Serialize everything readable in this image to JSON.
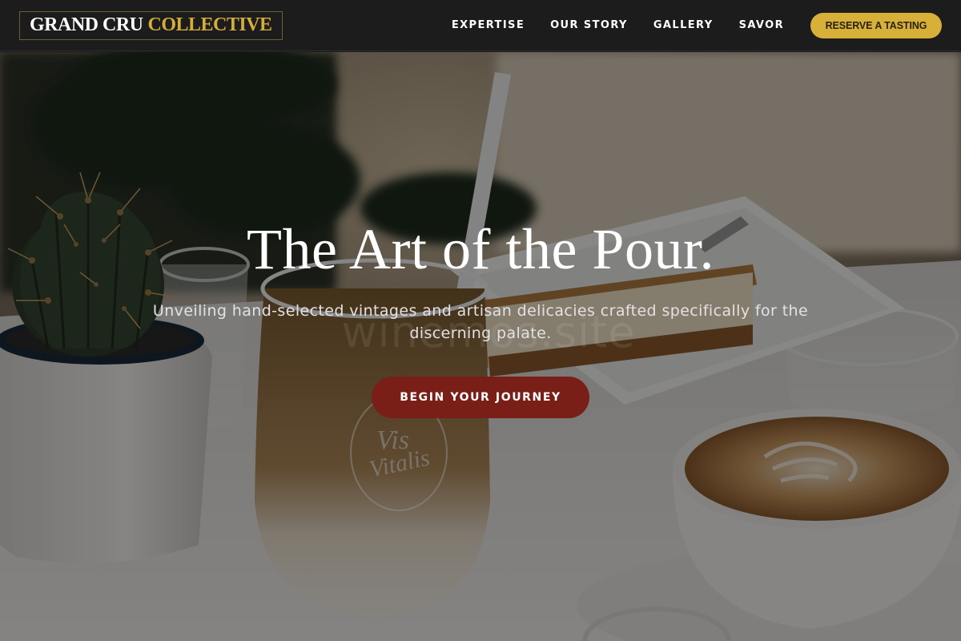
{
  "header": {
    "logo_primary": "GRAND CRU",
    "logo_accent": "COLLECTIVE",
    "nav": [
      {
        "label": "EXPERTISE"
      },
      {
        "label": "OUR STORY"
      },
      {
        "label": "GALLERY"
      },
      {
        "label": "SAVOR"
      }
    ],
    "cta_label": "RESERVE A TASTING"
  },
  "hero": {
    "title": "The Art of the Pour.",
    "subtitle": "Unveiling hand-selected vintages and artisan delicacies crafted specifically for the discerning palate.",
    "button_label": "BEGIN YOUR JOURNEY",
    "watermark": "winemos.site",
    "glass_engraving_line1": "Vis",
    "glass_engraving_line2": "Vitalis",
    "image_description": "cafe table with cactus pot, iced latte glass, cheesecake slice, latte art cup"
  },
  "colors": {
    "header_bg": "#1c1c1c",
    "gold_accent": "#d6b038",
    "cta_burgundy": "#7a1e18",
    "overlay": "#000000"
  }
}
